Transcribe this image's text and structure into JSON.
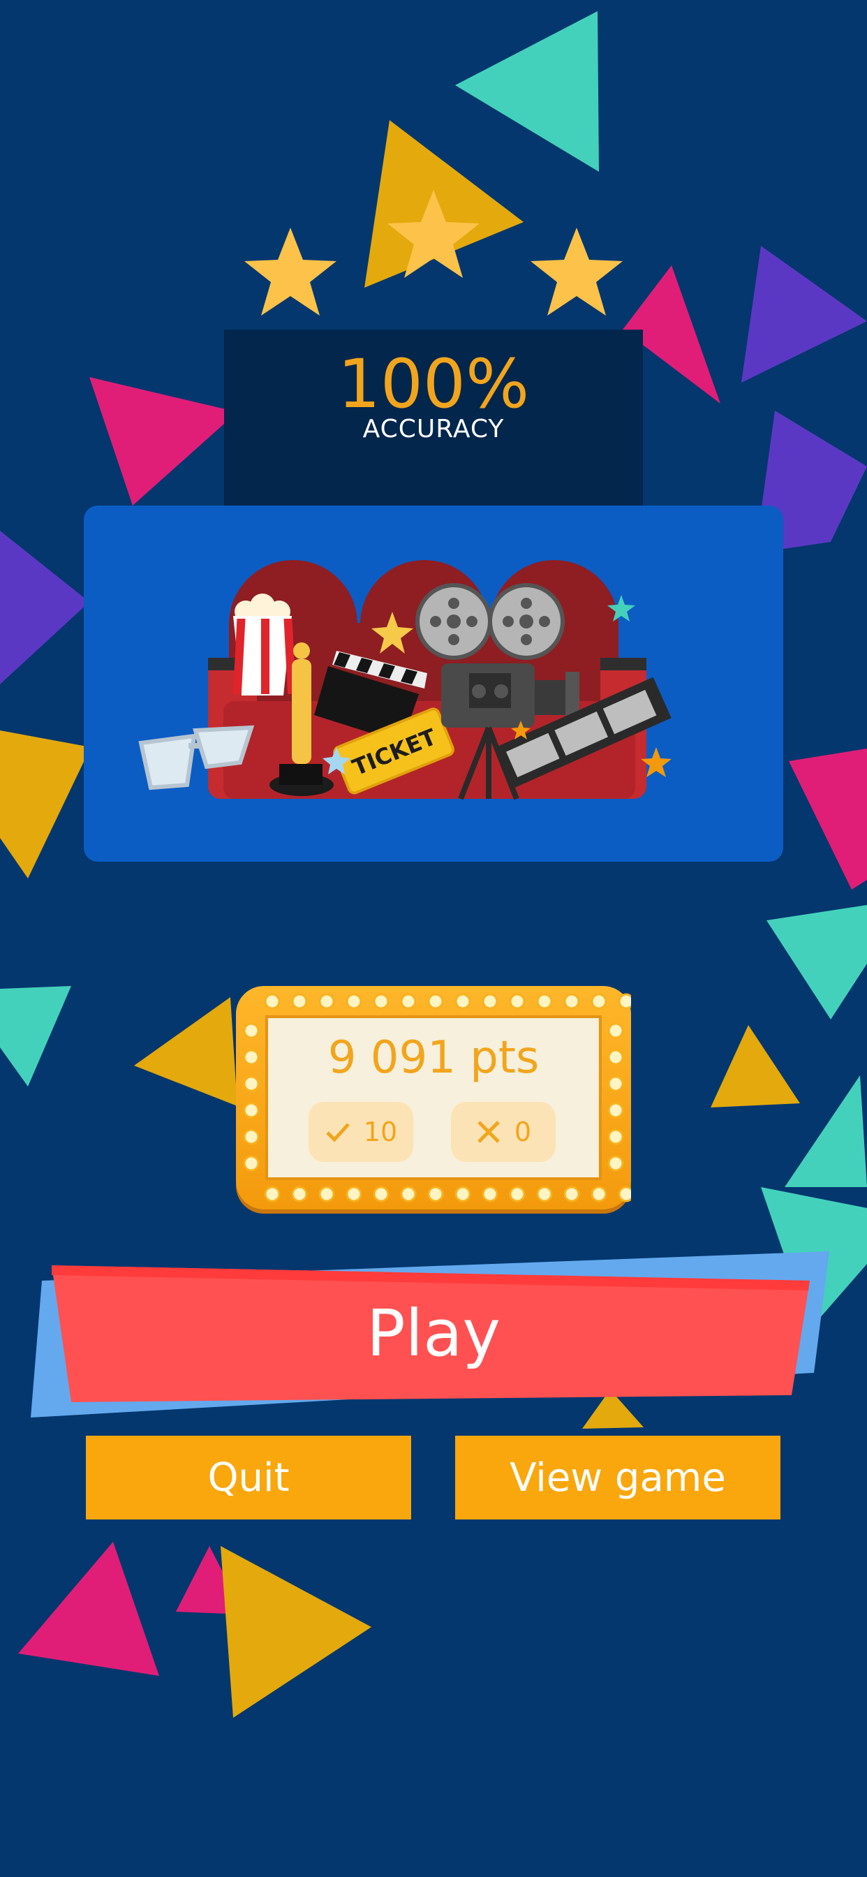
{
  "result": {
    "accuracy_value": "100%",
    "accuracy_label": "ACCURACY",
    "stars_earned": 3,
    "stars_total": 3
  },
  "score": {
    "points_text": "9 091 pts",
    "correct_count": "10",
    "wrong_count": "0"
  },
  "buttons": {
    "play_label": "Play",
    "quit_label": "Quit",
    "view_game_label": "View game"
  },
  "illustration": {
    "ticket_text": "TICKET"
  },
  "colors": {
    "background": "#03376E",
    "accent_orange": "#F2A51C",
    "play_red": "#FF5050",
    "button_yellow": "#F9A70D",
    "panel_blue": "#0B5DC4"
  }
}
